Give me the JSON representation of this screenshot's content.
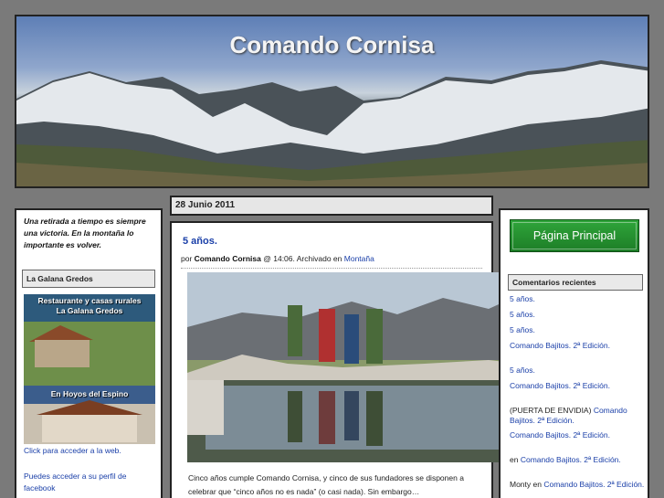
{
  "site": {
    "title": "Comando Cornisa"
  },
  "left": {
    "motto": "Una retirada a tiempo es siempre una victoria. En la montaña lo importante es volver.",
    "section_title": "La Galana Gredos",
    "promo_line1": "Restaurante y casas rurales",
    "promo_line2": "La Galana Gredos",
    "promo_line3": "En Hoyos del Espino",
    "web_link": "Click para acceder a la web.",
    "fb_link": "Puedes acceder a su perfil de facebook"
  },
  "post": {
    "date": "28 Junio 2011",
    "title": "5 años.",
    "meta_by": "por",
    "meta_author": "Comando Cornisa",
    "meta_time": "@ 14:06. Archivado en",
    "meta_category": "Montaña",
    "excerpt": "Cinco años cumple Comando Cornisa, y cinco de sus fundadores se disponen a celebrar que “cinco años no es nada” (o casi nada). Sin embargo…"
  },
  "right": {
    "main_button": "Página Principal",
    "section_title": "Comentarios recientes",
    "comments": [
      {
        "prefix": "",
        "link": "5 años."
      },
      {
        "prefix": "",
        "link": "5 años."
      },
      {
        "prefix": "",
        "link": "5 años."
      },
      {
        "prefix": "",
        "link": "Comando Bajitos. 2ª Edición."
      },
      {
        "prefix": "",
        "link": "5 años."
      },
      {
        "prefix": "",
        "link": "Comando Bajitos. 2ª Edición."
      },
      {
        "prefix": "(PUERTA DE ENVIDIA)",
        "link": "Comando Bajitos. 2ª Edición."
      },
      {
        "prefix": "",
        "link": "Comando Bajitos. 2ª Edición."
      },
      {
        "prefix": "en",
        "link": "Comando Bajitos. 2ª Edición."
      },
      {
        "prefix": "Monty en",
        "link": "Comando Bajitos. 2ª Edición."
      }
    ]
  },
  "colors": {
    "link": "#1a3fa8",
    "button": "#2fa53a",
    "background": "#7a7a7a"
  },
  "icons": {
    "header_image": "mountain-banner",
    "post_image": "mountaineers-by-lake"
  }
}
